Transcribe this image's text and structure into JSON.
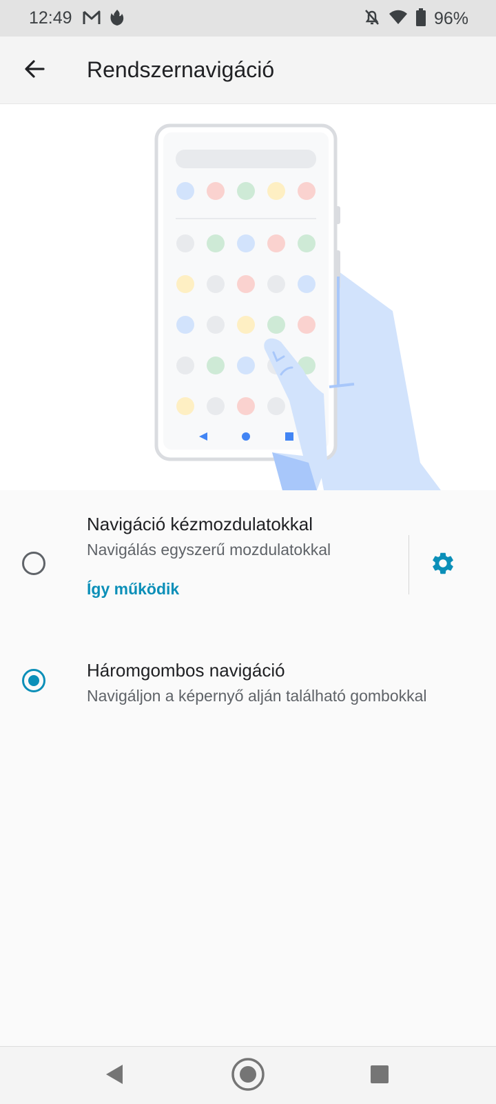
{
  "status_bar": {
    "time": "12:49",
    "battery_percent": "96%",
    "icons": [
      "gmail-icon",
      "app-notification-icon",
      "do-not-disturb-off-icon",
      "wifi-icon",
      "battery-icon"
    ]
  },
  "app_bar": {
    "title": "Rendszernavigáció",
    "back_icon": "arrow-back-icon"
  },
  "options": [
    {
      "title": "Navigáció kézmozdulatokkal",
      "summary": "Navigálás egyszerű mozdulatokkal",
      "link": "Így működik",
      "selected": false,
      "settings_icon": "gear-icon"
    },
    {
      "title": "Háromgombos navigáció",
      "summary": "Navigáljon a képernyő alján található gombokkal",
      "selected": true
    }
  ],
  "colors": {
    "accent": "#0b8fb8",
    "hand": "#d2e3fc",
    "hand_dark": "#a8c7fa",
    "nav_blue": "#4285f4"
  },
  "nav_bar": {
    "icons": [
      "back-triangle-icon",
      "home-circle-icon",
      "recents-square-icon"
    ]
  }
}
